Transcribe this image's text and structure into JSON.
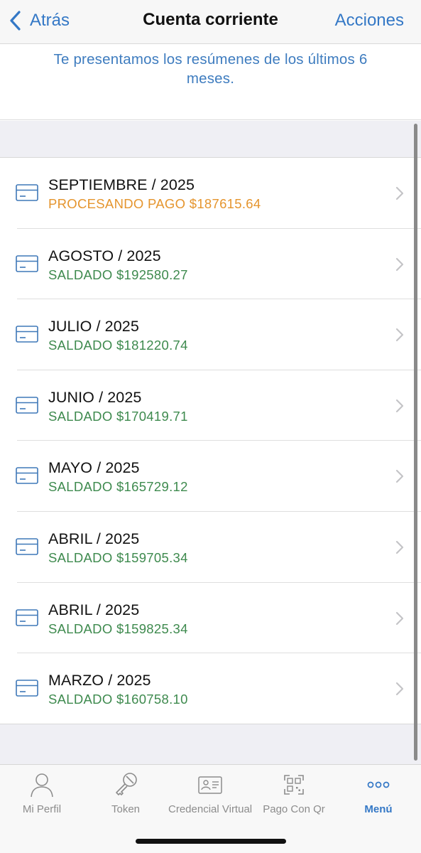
{
  "navbar": {
    "back_label": "Atrás",
    "title": "Cuenta corriente",
    "action_label": "Acciones"
  },
  "intro": {
    "text": "Te presentamos los resúmenes de los últimos 6 meses."
  },
  "colors": {
    "accent": "#3478c6",
    "paid": "#3e8a4e",
    "processing": "#e5952e"
  },
  "statements": [
    {
      "period": "SEPTIEMBRE / 2025",
      "status": "PROCESANDO PAGO $187615.64",
      "state": "processing",
      "icon": "credit-card-icon"
    },
    {
      "period": "AGOSTO / 2025",
      "status": "SALDADO $192580.27",
      "state": "paid",
      "icon": "credit-card-icon"
    },
    {
      "period": "JULIO / 2025",
      "status": "SALDADO $181220.74",
      "state": "paid",
      "icon": "credit-card-icon"
    },
    {
      "period": "JUNIO / 2025",
      "status": "SALDADO $170419.71",
      "state": "paid",
      "icon": "credit-card-icon"
    },
    {
      "period": "MAYO / 2025",
      "status": "SALDADO $165729.12",
      "state": "paid",
      "icon": "credit-card-icon"
    },
    {
      "period": "ABRIL / 2025",
      "status": "SALDADO $159705.34",
      "state": "paid",
      "icon": "credit-card-icon"
    },
    {
      "period": "ABRIL / 2025",
      "status": "SALDADO $159825.34",
      "state": "paid",
      "icon": "credit-card-icon"
    },
    {
      "period": "MARZO / 2025",
      "status": "SALDADO $160758.10",
      "state": "paid",
      "icon": "credit-card-icon"
    }
  ],
  "tabbar": {
    "active": "menu",
    "tabs": [
      {
        "id": "perfil",
        "label": "Mi Perfil",
        "icon": "user-icon"
      },
      {
        "id": "token",
        "label": "Token",
        "icon": "key-icon"
      },
      {
        "id": "credencial",
        "label": "Credencial Virtual",
        "icon": "id-card-icon"
      },
      {
        "id": "qr",
        "label": "Pago Con Qr",
        "icon": "qr-code-icon"
      },
      {
        "id": "menu",
        "label": "Menú",
        "icon": "more-icon"
      }
    ]
  }
}
